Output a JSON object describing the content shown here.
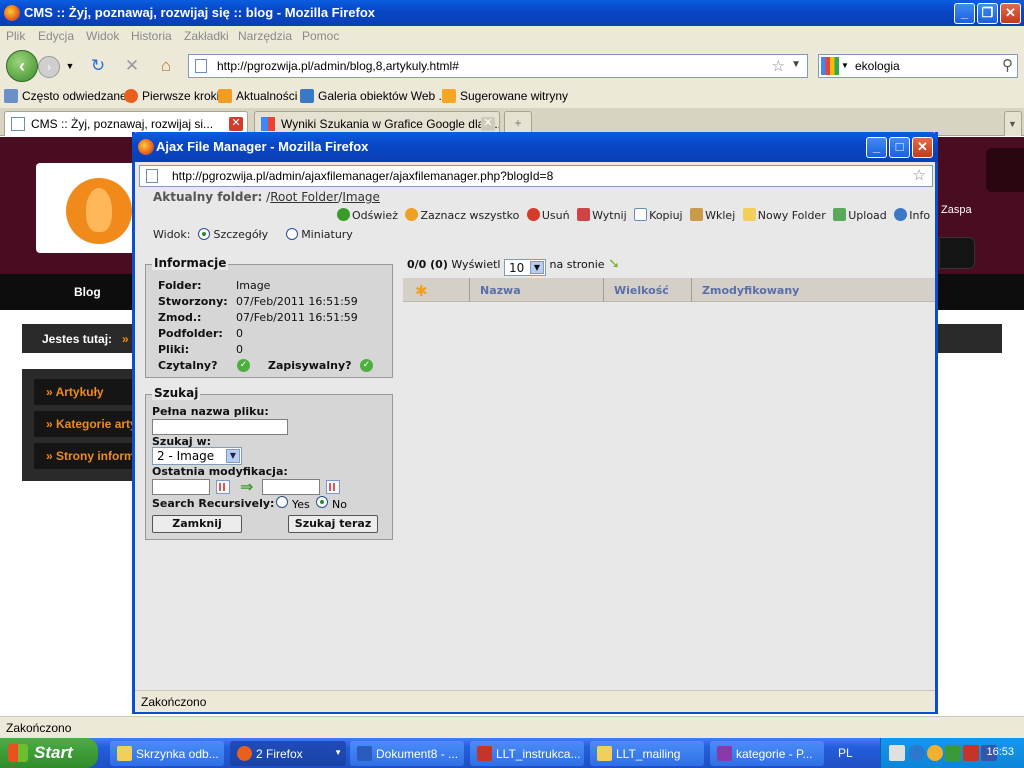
{
  "browser": {
    "title": "CMS :: Żyj, poznawaj, rozwijaj się :: blog - Mozilla Firefox",
    "menu": [
      "Plik",
      "Edycja",
      "Widok",
      "Historia",
      "Zakładki",
      "Narzędzia",
      "Pomoc"
    ],
    "url": "http://pgrozwija.pl/admin/blog,8,artykuly.html#",
    "search": "ekologia",
    "bookmarks": [
      "Często odwiedzane",
      "Pierwsze kroki",
      "Aktualności",
      "Galeria obiektów Web ...",
      "Sugerowane witryny"
    ],
    "tabs": [
      "CMS :: Żyj, poznawaj, rozwijaj si...",
      "Wyniki Szukania w Grafice Google dla h..."
    ],
    "status": "Zakończono"
  },
  "site": {
    "nav_blog": "Blog",
    "breadcrumb_label": "Jestes tutaj:",
    "breadcrumb_arrow": "»",
    "right_text": "Zaspa",
    "side_items": [
      "» Artykuły",
      "» Kategorie artykułów",
      "» Strony informacyjne"
    ]
  },
  "popup": {
    "title": "Ajax File Manager - Mozilla Firefox",
    "url": "http://pgrozwija.pl/admin/ajaxfilemanager/ajaxfilemanager.php?blogId=8",
    "folder_label": "Aktualny folder:",
    "folder_slash": "/",
    "folder_root": "Root Folder",
    "folder_sep": "/",
    "folder_current": "Image",
    "toolbar": [
      "Odśwież",
      "Zaznacz wszystko",
      "Usuń",
      "Wytnij",
      "Kopiuj",
      "Wklej",
      "Nowy Folder",
      "Upload",
      "Info"
    ],
    "view_label": "Widok:",
    "view_details": "Szczegóły",
    "view_thumbs": "Miniatury",
    "info": {
      "legend": "Informacje",
      "rows": [
        {
          "label": "Folder:",
          "value": "Image"
        },
        {
          "label": "Stworzony:",
          "value": "07/Feb/2011 16:51:59"
        },
        {
          "label": "Zmod.:",
          "value": "07/Feb/2011 16:51:59"
        },
        {
          "label": "Podfolder:",
          "value": "0"
        },
        {
          "label": "Pliki:",
          "value": "0"
        }
      ],
      "readable": "Czytalny?",
      "writable": "Zapisywalny?"
    },
    "search": {
      "legend": "Szukaj",
      "filename_label": "Pełna nazwa pliku:",
      "search_in_label": "Szukaj w:",
      "search_in_value": "2 - Image",
      "modified_label": "Ostatnia modyfikacja:",
      "recursive_label": "Search Recursively:",
      "yes": "Yes",
      "no": "No",
      "close_btn": "Zamknij",
      "search_btn": "Szukaj teraz"
    },
    "paging": {
      "count": "0/0 (0)",
      "show": "Wyświetl",
      "per_page": "10",
      "per_page_label": "na stronie"
    },
    "columns": [
      "Nazwa",
      "Wielkość",
      "Zmodyfikowany"
    ],
    "status": "Zakończono"
  },
  "taskbar": {
    "start": "Start",
    "tasks": [
      "Skrzynka odb...",
      "2 Firefox",
      "Dokument8 - ...",
      "LLT_instrukca...",
      "LLT_mailing",
      "kategorie - P..."
    ],
    "lang": "PL",
    "clock": "16:53"
  }
}
